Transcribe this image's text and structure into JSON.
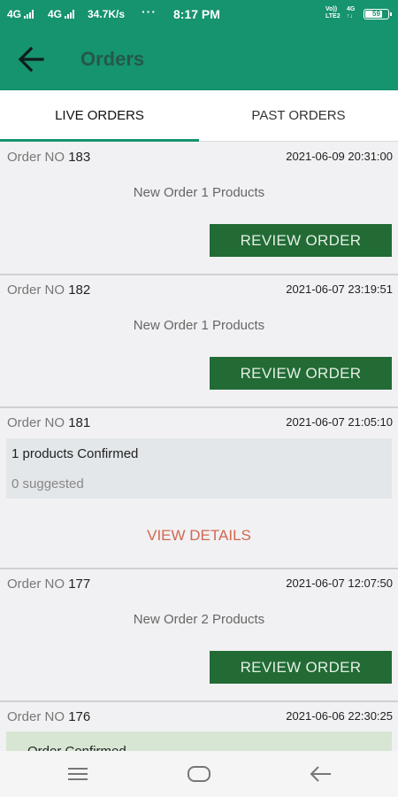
{
  "status_bar": {
    "sim1_label": "4G",
    "sim2_label": "4G",
    "speed": "34.7K/s",
    "dots": "···",
    "time": "8:17 PM",
    "volte_top": "Vo))",
    "volte_bottom": "LTE2",
    "net_top": "4G",
    "net_bottom": "↑↓",
    "battery_level": "59"
  },
  "app_bar": {
    "back_icon": "arrow-left-icon",
    "title": "Orders"
  },
  "tabs": [
    {
      "label": "LIVE ORDERS",
      "active": true
    },
    {
      "label": "PAST ORDERS",
      "active": false
    }
  ],
  "orders": [
    {
      "label": "Order NO",
      "number": "183",
      "date": "2021-06-09 20:31:00",
      "summary": "New Order 1 Products",
      "button": "REVIEW ORDER"
    },
    {
      "label": "Order NO",
      "number": "182",
      "date": "2021-06-07 23:19:51",
      "summary": "New Order 1 Products",
      "button": "REVIEW ORDER"
    },
    {
      "label": "Order NO",
      "number": "181",
      "date": "2021-06-07 21:05:10",
      "confirmed": "1 products Confirmed",
      "suggested": "0 suggested",
      "button": "VIEW DETAILS"
    },
    {
      "label": "Order NO",
      "number": "177",
      "date": "2021-06-07 12:07:50",
      "summary": "New Order 2 Products",
      "button": "REVIEW ORDER"
    },
    {
      "label": "Order NO",
      "number": "176",
      "date": "2021-06-06 22:30:25",
      "status": "Order Confirmed"
    }
  ],
  "nav_bar": {
    "menu_icon": "recents-icon",
    "home_icon": "home-icon",
    "back_icon": "back-icon"
  },
  "colors": {
    "primary": "#16936f",
    "button": "#226b35",
    "link": "#d3684f"
  }
}
